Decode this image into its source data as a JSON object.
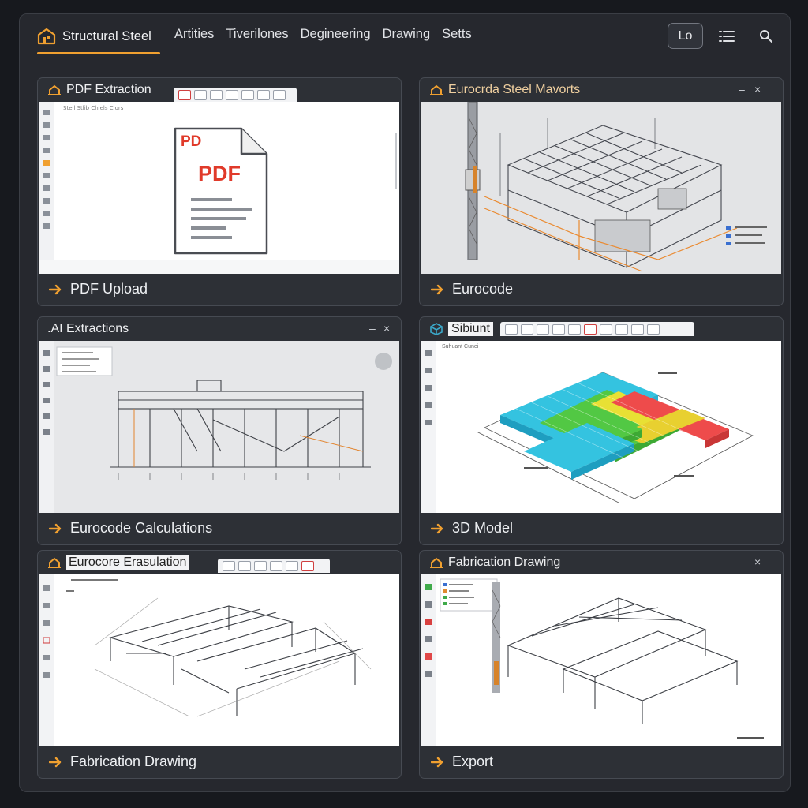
{
  "topbar": {
    "brand": "Structural Steel",
    "nav": [
      "Artities",
      "Tiverilones",
      "Degineering",
      "Drawing",
      "Setts"
    ],
    "pill_label": "Lo",
    "icons": [
      "list-icon",
      "search-icon"
    ],
    "accent": "#f0a030"
  },
  "cards": [
    {
      "title": "PDF Extraction",
      "footer": "PDF Upload",
      "pdf_corner": "PD",
      "pdf_center": "PDF",
      "doc_line": "Stell Stlib Chiels Ciors",
      "controls": []
    },
    {
      "title": "Eurocrda Steel Mavorts",
      "footer": "Eurocode",
      "controls": [
        "–",
        "×"
      ]
    },
    {
      "title": ".AI Extractions",
      "footer": "Eurocode Calculations",
      "controls": [
        "–",
        "×"
      ]
    },
    {
      "title": "Sibiunt",
      "footer": "3D Model",
      "doc_line": "Suhuant Cunei",
      "controls": []
    },
    {
      "title": "Eurocore Erasulation",
      "footer": "Fabrication Drawing",
      "controls": []
    },
    {
      "title": "Fabrication Drawing",
      "footer": "Export",
      "controls": [
        "–",
        "×"
      ]
    }
  ],
  "colors": {
    "app_bg": "#26282e",
    "card_bg": "#2d3036",
    "accent": "#f0a030",
    "pdf_red": "#e03a2a"
  }
}
